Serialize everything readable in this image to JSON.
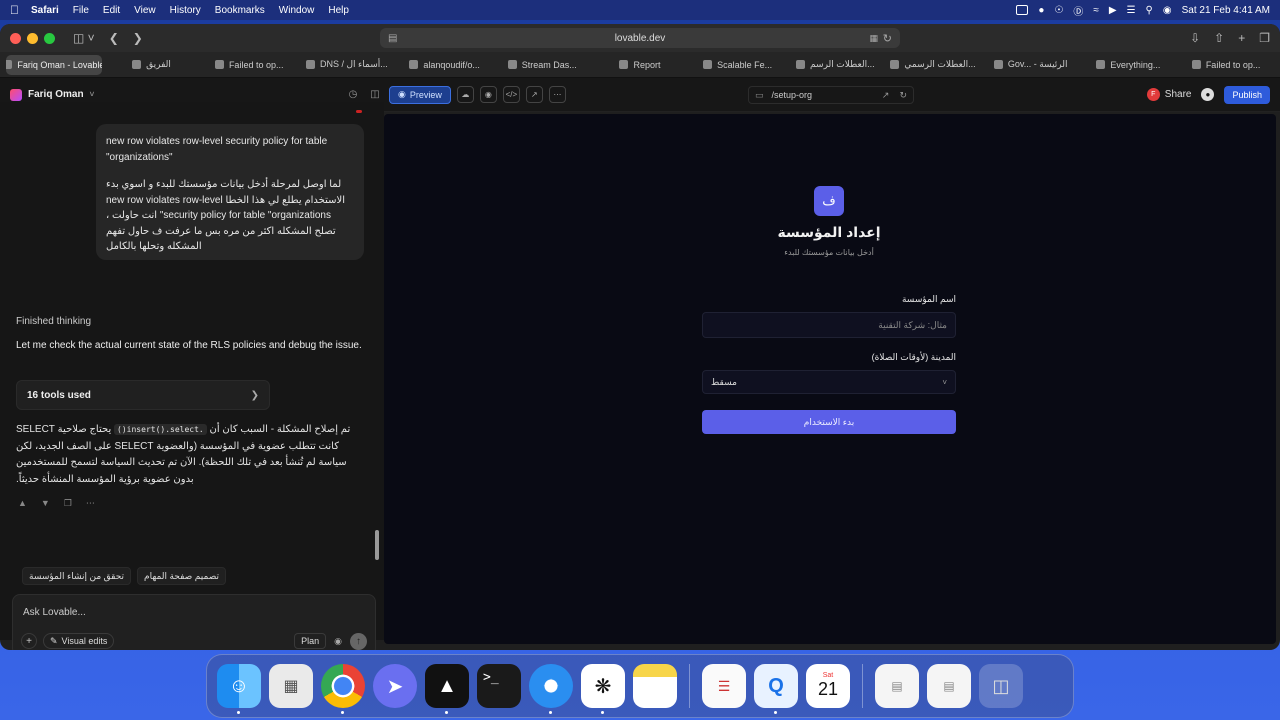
{
  "menubar": {
    "app": "Safari",
    "items": [
      "File",
      "Edit",
      "View",
      "History",
      "Bookmarks",
      "Window",
      "Help"
    ],
    "datetime": "Sat 21 Feb 4:41 AM"
  },
  "browser": {
    "url": "lovable.dev",
    "tabs": [
      {
        "label": "Fariq Oman - Lovable",
        "active": true
      },
      {
        "label": "الفريق"
      },
      {
        "label": "Failed to op..."
      },
      {
        "label": "DNS / أسماء ال..."
      },
      {
        "label": "alanqoudif/o..."
      },
      {
        "label": "Stream Das..."
      },
      {
        "label": "Report"
      },
      {
        "label": "Scalable Fe..."
      },
      {
        "label": "العطلات الرسم..."
      },
      {
        "label": "العطلات الرسمي..."
      },
      {
        "label": "Gov... - الرئيسة"
      },
      {
        "label": "Everything..."
      },
      {
        "label": "Failed to op..."
      }
    ]
  },
  "header": {
    "project_name": "Fariq Oman",
    "preview_label": "Preview",
    "route": "/setup-org",
    "share_label": "Share",
    "share_avatar": "F",
    "publish_label": "Publish"
  },
  "chat": {
    "user_message_en": "new row violates row-level security policy for table \"organizations\"",
    "user_message_ar": "لما اوصل لمرحلة أدخل بيانات مؤسستك للبدء و اسوي بدء الاستخدام يطلع لي هذا الخطا new row violates row-level security policy for table \"organizations\" انت حاولت ، تصلح المشكله اكثر من مره بس ما عرفت ف حاول تفهم المشكله وتحلها بالكامل",
    "thinking": "Finished thinking",
    "reply": "Let me check the actual current state of the RLS policies and debug the issue.",
    "tools_used": "16 tools used",
    "reply_ar_1": "تم إصلاح المشكلة - السبب كان أن",
    "reply_ar_code": ".insert().select()",
    "reply_ar_2": "يحتاج صلاحية SELECT كانت تتطلب عضوية في المؤسسة (والعضوية SELECT على الصف الجديد، لكن سياسة لم تُنشأ بعد في تلك اللحظة). الآن تم تحديث السياسة لتسمح للمستخدمين بدون عضوية برؤية المؤسسة المنشأة حديثاً.",
    "suggestions": [
      "تحقق من إنشاء المؤسسة",
      "تصميم صفحة المهام"
    ],
    "composer_placeholder": "Ask Lovable...",
    "visual_edits": "Visual edits",
    "plan": "Plan"
  },
  "preview_form": {
    "logo_letter": "ف",
    "title": "إعداد المؤسسة",
    "subtitle": "أدخل بيانات مؤسستك للبدء",
    "name_label": "اسم المؤسسة",
    "name_placeholder": "مثال: شركة التقنية",
    "city_label": "المدينة (لأوقات الصلاة)",
    "city_value": "مسقط",
    "submit_label": "بدء الاستخدام"
  },
  "dock": {
    "calendar_month": "Sat",
    "calendar_day": "21",
    "apps": [
      "finder-icon",
      "launchpad-icon",
      "chrome-icon",
      "vpn-icon",
      "cube-icon",
      "terminal-icon",
      "safari-icon",
      "chatgpt-icon",
      "notes-icon",
      "textedit-icon",
      "qbrowser-icon",
      "calendar-icon",
      "document-icon",
      "preview-doc-icon",
      "trash-icon"
    ]
  },
  "colors": {
    "accent": "#5b5fe8",
    "publish": "#2e5bdb",
    "preview_bg": "#090a14"
  }
}
